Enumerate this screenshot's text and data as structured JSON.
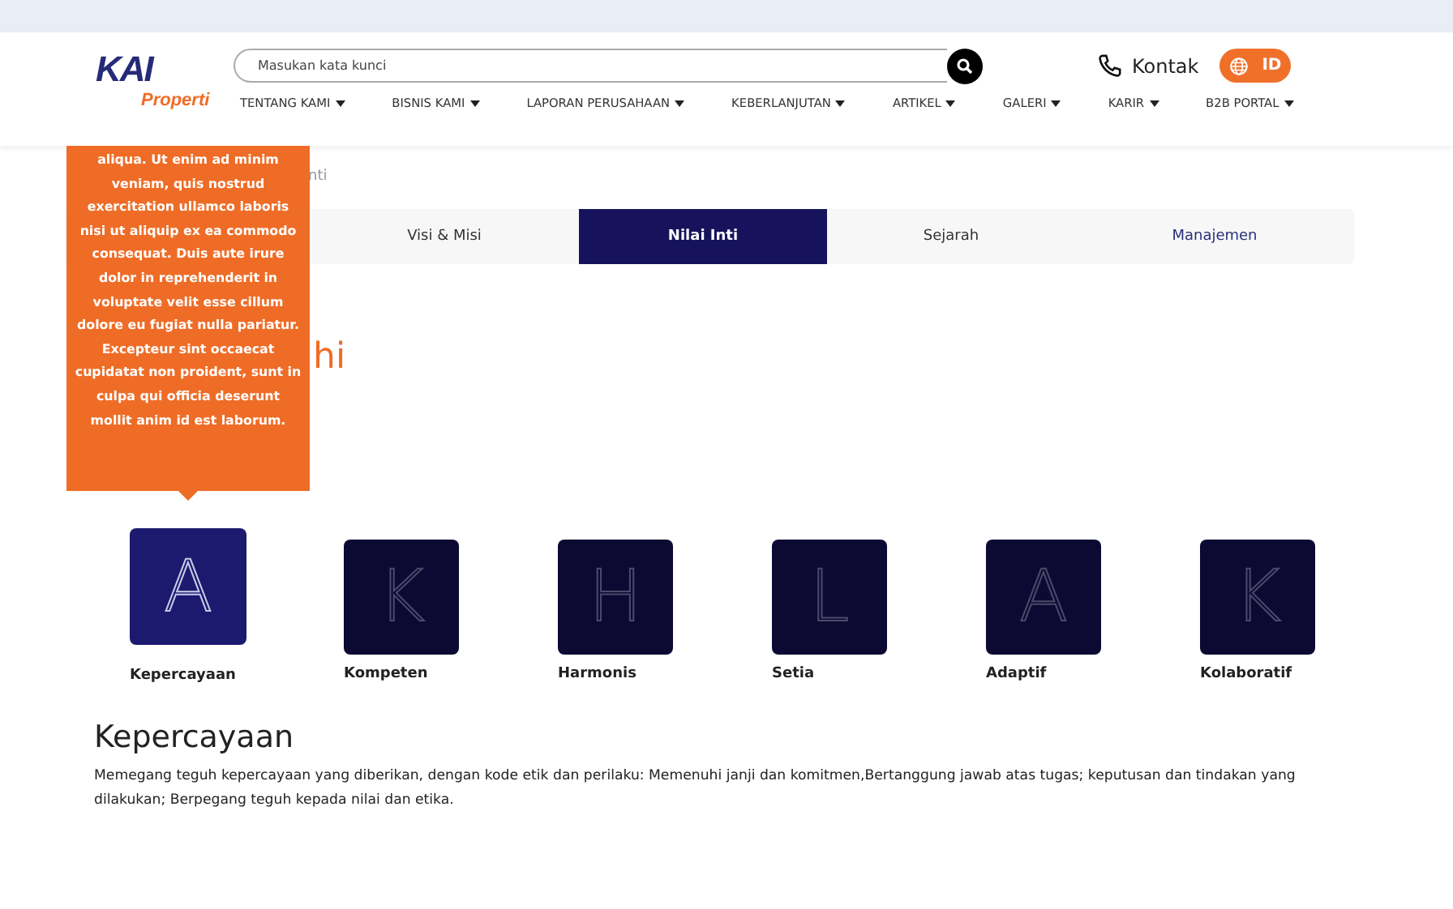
{
  "header": {
    "logo": {
      "mark": "KAI",
      "sub": "Properti"
    },
    "search": {
      "placeholder": "Masukan kata kunci"
    },
    "contact": "Kontak",
    "language": "ID",
    "nav": [
      "TENTANG KAMI",
      "BISNIS KAMI",
      "LAPORAN PERUSAHAAN",
      "KEBERLANJUTAN",
      "ARTIKEL",
      "GALERI",
      "KARIR",
      "B2B PORTAL"
    ]
  },
  "tooltip": "aliqua. Ut enim ad minim veniam, quis nostrud exercitation ullamco laboris nisi ut aliquip ex ea commodo consequat. Duis aute irure dolor in reprehenderit in voluptate velit esse cillum dolore eu fugiat nulla pariatur. Excepteur sint occaecat cupidatat non proident, sunt in culpa qui officia deserunt mollit anim id est laborum.",
  "breadcrumb_fragment": "nti",
  "tabs": [
    {
      "label": "Visi & Misi",
      "selected": false
    },
    {
      "label": "Nilai Inti",
      "selected": true
    },
    {
      "label": "Sejarah",
      "selected": false
    },
    {
      "label": "Manajemen",
      "selected": false
    }
  ],
  "heading_fragment": "hi",
  "values": [
    {
      "letter": "A",
      "label": "Kepercayaan",
      "selected": true
    },
    {
      "letter": "K",
      "label": "Kompeten",
      "selected": false
    },
    {
      "letter": "H",
      "label": "Harmonis",
      "selected": false
    },
    {
      "letter": "L",
      "label": "Setia",
      "selected": false
    },
    {
      "letter": "A",
      "label": "Adaptif",
      "selected": false
    },
    {
      "letter": "K",
      "label": "Kolaboratif",
      "selected": false
    }
  ],
  "detail": {
    "title": "Kepercayaan",
    "text": "Memegang teguh kepercayaan yang diberikan, dengan kode etik dan perilaku: Memenuhi janji dan komitmen,Bertanggung jawab atas tugas; keputusan dan tindakan yang dilakukan; Berpegang teguh kepada nilai dan etika."
  }
}
